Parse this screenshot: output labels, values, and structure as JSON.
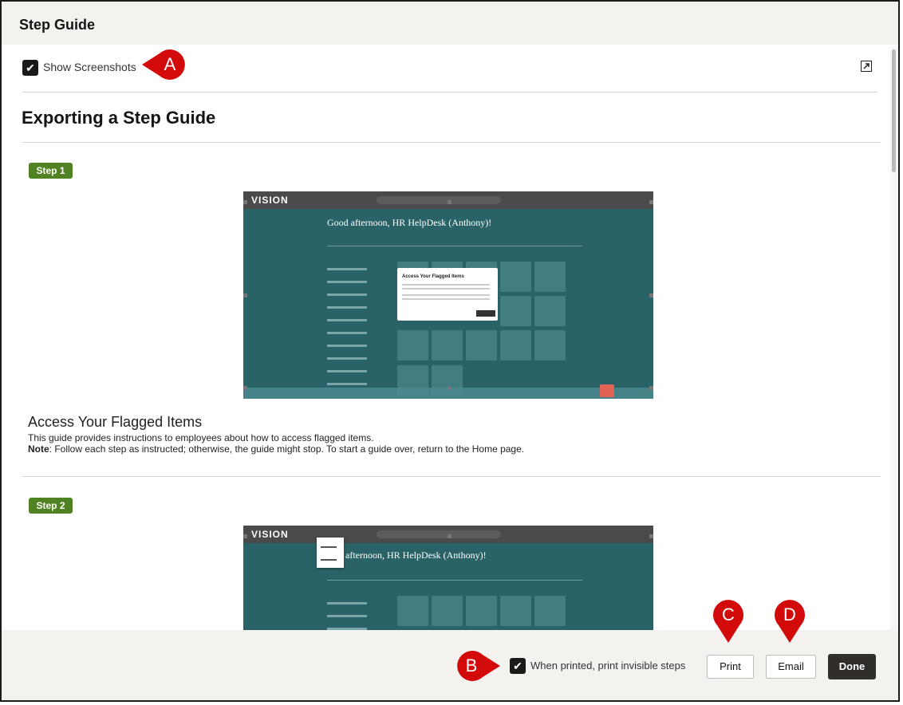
{
  "dialog": {
    "title": "Step Guide"
  },
  "toolbar": {
    "show_screenshots_label": "Show Screenshots",
    "show_screenshots_checked": true
  },
  "guide": {
    "title": "Exporting a Step Guide",
    "steps": [
      {
        "label": "Step 1",
        "screenshot": {
          "logo": "VISION",
          "greeting": "Good afternoon, HR HelpDesk (Anthony)!",
          "popup_title": "Access Your Flagged Items"
        },
        "title": "Access Your Flagged Items",
        "description": "This guide provides instructions to employees about how to access flagged items.",
        "note_label": "Note",
        "note_text": ": Follow each step as instructed; otherwise, the guide might stop. To start a guide over, return to the Home page."
      },
      {
        "label": "Step 2",
        "screenshot": {
          "logo": "VISION",
          "greeting": "afternoon, HR HelpDesk (Anthony)!"
        }
      }
    ]
  },
  "footer": {
    "print_invisible_label": "When printed, print invisible steps",
    "print_invisible_checked": true,
    "print_label": "Print",
    "email_label": "Email",
    "done_label": "Done"
  },
  "callouts": {
    "a": "A",
    "b": "B",
    "c": "C",
    "d": "D"
  },
  "colors": {
    "step_badge": "#508223",
    "callout": "#d20a0a",
    "done_button": "#312d2a",
    "screenshot_bg": "#2a6367"
  }
}
